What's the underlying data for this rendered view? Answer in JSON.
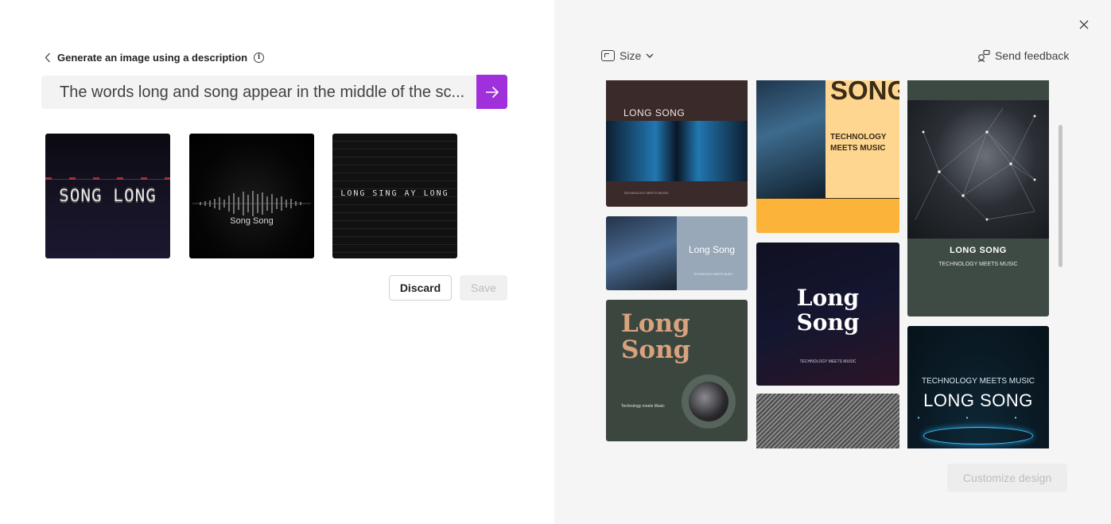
{
  "generator": {
    "back_label": "Generate an image using a description",
    "info_glyph": "i",
    "prompt_text": "The words long and song appear in the middle of the sc...",
    "results": [
      {
        "caption": "SONG LONG"
      },
      {
        "caption": "Song Song"
      },
      {
        "caption": "LONG SING AY LONG"
      }
    ],
    "discard_label": "Discard",
    "save_label": "Save",
    "accent_color": "#a030dc"
  },
  "designer": {
    "size_label": "Size",
    "feedback_label": "Send feedback",
    "customize_label": "Customize design",
    "templates": [
      {
        "title": "LONG SONG",
        "subtitle": "TECHNOLOGY MEETS MUSIC"
      },
      {
        "title": "SONG",
        "subtitle": "TECHNOLOGY MEETS MUSIC"
      },
      {
        "title": "LONG SONG",
        "subtitle": "TECHNOLOGY MEETS MUSIC"
      },
      {
        "title": "Long Song",
        "subtitle": "TECHNOLOGY MEETS MUSIC"
      },
      {
        "title_line1": "Long",
        "title_line2": "Song",
        "subtitle": "TECHNOLOGY MEETS MUSIC"
      },
      {
        "title_line1": "Long",
        "title_line2": "Song",
        "subtitle": "Technology meets Music"
      },
      {
        "title": ""
      },
      {
        "title": "LONG SONG",
        "subtitle": "TECHNOLOGY MEETS MUSIC"
      }
    ]
  },
  "icons": {
    "back": "chevron-left-icon",
    "info": "info-icon",
    "send": "arrow-right-icon",
    "size": "resize-icon",
    "size_dropdown": "chevron-down-icon",
    "feedback": "feedback-icon",
    "close": "close-icon"
  }
}
